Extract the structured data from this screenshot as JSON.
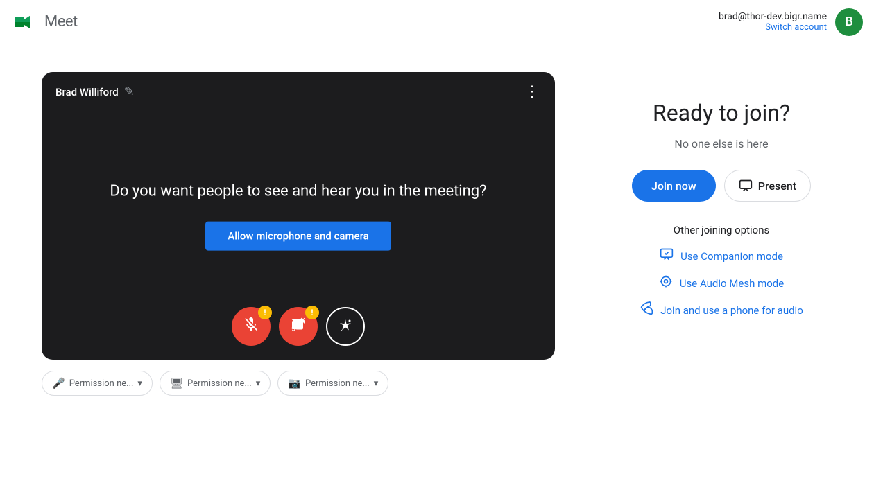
{
  "header": {
    "app_name": "Meet",
    "account_email": "brad@thor-dev.bigr.name",
    "switch_account_label": "Switch account",
    "avatar_letter": "B",
    "avatar_bg": "#1e8e3e"
  },
  "video_preview": {
    "user_name": "Brad Williford",
    "question": "Do you want people to see and hear you in the meeting?",
    "allow_button_label": "Allow microphone and camera",
    "controls": {
      "mic_muted": true,
      "camera_off": true
    }
  },
  "permissions": {
    "items": [
      {
        "label": "Permission ne...",
        "icon": "🎤"
      },
      {
        "label": "Permission ne...",
        "icon": "🖥"
      },
      {
        "label": "Permission ne...",
        "icon": "📷"
      }
    ]
  },
  "right_panel": {
    "ready_title": "Ready to join?",
    "no_one_text": "No one else is here",
    "join_now_label": "Join now",
    "present_label": "Present",
    "other_options_title": "Other joining options",
    "other_options": [
      {
        "label": "Use Companion mode",
        "icon": "companion"
      },
      {
        "label": "Use Audio Mesh mode",
        "icon": "audio-mesh"
      },
      {
        "label": "Join and use a phone for audio",
        "icon": "phone"
      }
    ]
  }
}
